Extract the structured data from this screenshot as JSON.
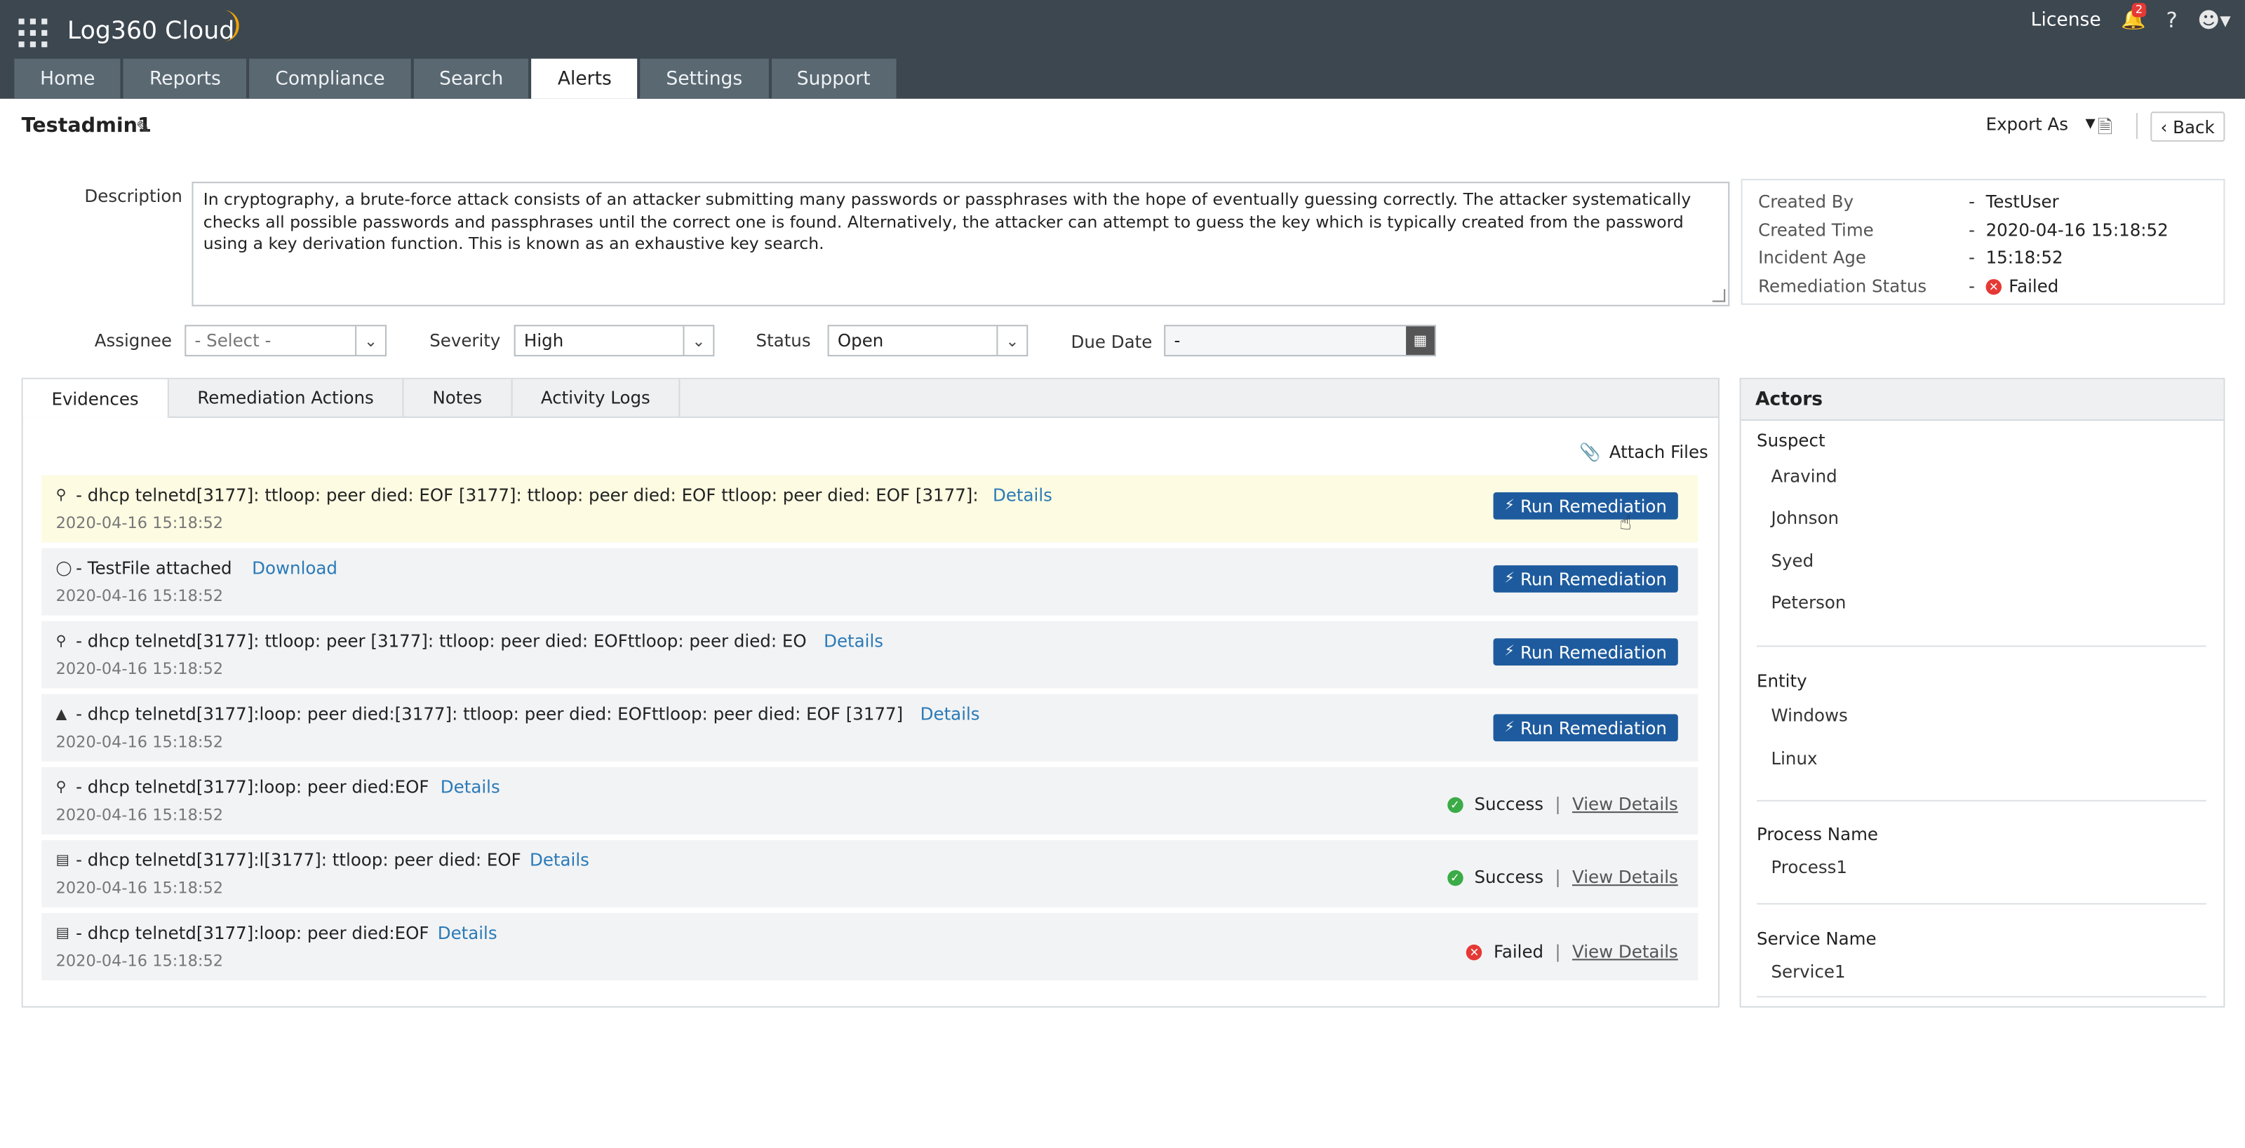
{
  "app": {
    "logo": "Log360 Cloud"
  },
  "topbar": {
    "license": "License",
    "notif_count": "2",
    "help": "?"
  },
  "tabs": [
    "Home",
    "Reports",
    "Compliance",
    "Search",
    "Alerts",
    "Settings",
    "Support"
  ],
  "active_tab": "Alerts",
  "header": {
    "title": "Testadmin1",
    "export_label": "Export As",
    "back_label": "Back"
  },
  "description": {
    "label": "Description",
    "text": "In cryptography, a brute-force attack consists of an attacker submitting many passwords or passphrases with the hope of eventually guessing correctly. The attacker systematically checks all possible passwords and passphrases until the correct one is found. Alternatively, the attacker can attempt to guess the key which is typically created from the password using a key derivation function. This is known as an exhaustive key search."
  },
  "info": {
    "created_by_label": "Created By",
    "created_by": "TestUser",
    "created_time_label": "Created Time",
    "created_time": "2020-04-16 15:18:52",
    "incident_age_label": "Incident Age",
    "incident_age": "15:18:52",
    "remediation_status_label": "Remediation Status",
    "remediation_status": "Failed",
    "dash": "-"
  },
  "fields": {
    "assignee_label": "Assignee",
    "assignee": "- Select -",
    "severity_label": "Severity",
    "severity": "High",
    "status_label": "Status",
    "status": "Open",
    "due_date_label": "Due Date",
    "due_date": "-"
  },
  "subtabs": [
    "Evidences",
    "Remediation Actions",
    "Notes",
    "Activity Logs"
  ],
  "attach_label": "Attach Files",
  "evidences": [
    {
      "icon": "search-icon",
      "text": "- dhcp telnetd[3177]: ttloop: peer died: EOF [3177]: ttloop: peer died: EOF ttloop: peer died: EOF [3177]:",
      "link": "Details",
      "time": "2020-04-16 15:18:52",
      "action": "Run Remediation"
    },
    {
      "icon": "shield-icon",
      "text": "- TestFile attached",
      "link": "Download",
      "time": "2020-04-16 15:18:52",
      "action": "Run Remediation"
    },
    {
      "icon": "search-icon",
      "text": "- dhcp telnetd[3177]: ttloop: peer [3177]: ttloop: peer died: EOFttloop: peer died: EO",
      "link": "Details",
      "time": "2020-04-16 15:18:52",
      "action": "Run Remediation"
    },
    {
      "icon": "bell-icon",
      "text": "- dhcp telnetd[3177]:loop: peer died:[3177]: ttloop: peer died: EOFttloop: peer died: EOF [3177]",
      "link": "Details",
      "time": "2020-04-16 15:18:52",
      "action": "Run Remediation"
    },
    {
      "icon": "search-icon",
      "text": "- dhcp telnetd[3177]:loop: peer died:EOF",
      "link": "Details",
      "time": "2020-04-16 15:18:52",
      "status": "Success",
      "view": "View Details"
    },
    {
      "icon": "document-icon",
      "text": "- dhcp telnetd[3177]:l[3177]: ttloop: peer died: EOF",
      "link": "Details",
      "time": "2020-04-16 15:18:52",
      "status": "Success",
      "view": "View Details"
    },
    {
      "icon": "document-icon",
      "text": "- dhcp telnetd[3177]:loop: peer died:EOF",
      "link": "Details",
      "time": "2020-04-16 15:18:52",
      "status": "Failed",
      "view": "View Details"
    }
  ],
  "actors": {
    "title": "Actors",
    "suspect_label": "Suspect",
    "suspects": [
      "Aravind",
      "Johnson",
      "Syed",
      "Peterson"
    ],
    "entity_label": "Entity",
    "entities": [
      "Windows",
      "Linux"
    ],
    "process_label": "Process Name",
    "process": "Process1",
    "service_label": "Service Name",
    "service": "Service1"
  },
  "colors": {
    "topbar": "#3c4750",
    "tab": "#5a6872",
    "button": "#1e5b9e",
    "link": "#2a7ab8",
    "highlight_row": "#fdfbe2",
    "success": "#3aab46",
    "failed": "#e53935"
  }
}
